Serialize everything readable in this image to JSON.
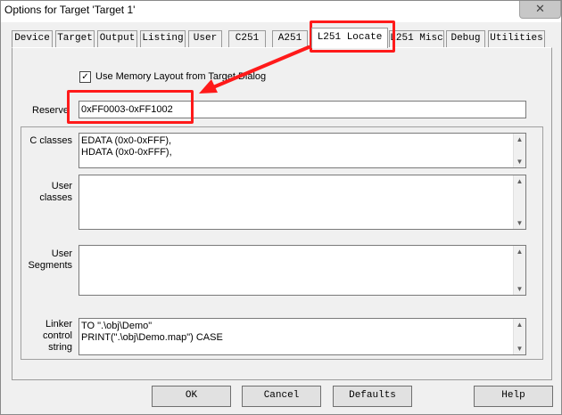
{
  "window": {
    "title": "Options for Target 'Target 1'",
    "close_glyph": "✕"
  },
  "tabs": [
    {
      "label": "Device"
    },
    {
      "label": "Target"
    },
    {
      "label": "Output"
    },
    {
      "label": "Listing"
    },
    {
      "label": "User"
    },
    {
      "label": "C251"
    },
    {
      "label": "A251"
    },
    {
      "label": "L251 Locate",
      "active": true
    },
    {
      "label": "L251 Misc"
    },
    {
      "label": "Debug"
    },
    {
      "label": "Utilities"
    }
  ],
  "locate": {
    "use_memory_layout_label": "Use Memory Layout from Target Dialog",
    "use_memory_layout_checked": "✓",
    "reserve_label": "Reserve",
    "reserve_value": "0xFF0003-0xFF1002",
    "c_classes_label": "C classes",
    "c_classes_lines": "EDATA (0x0-0xFFF),\nHDATA (0x0-0xFFF),",
    "user_classes_label": "User classes",
    "user_classes_lines": "",
    "user_segments_label": "User Segments",
    "user_segments_lines": "",
    "linker_control_label": "Linker control string",
    "linker_control_lines": "TO \".\\obj\\Demo\"\nPRINT(\".\\obj\\Demo.map\") CASE"
  },
  "buttons": {
    "ok": "OK",
    "cancel": "Cancel",
    "defaults": "Defaults",
    "help": "Help"
  },
  "scroll_up_glyph": "▲",
  "scroll_down_glyph": "▼",
  "annotation_color": "#ff1a1a"
}
